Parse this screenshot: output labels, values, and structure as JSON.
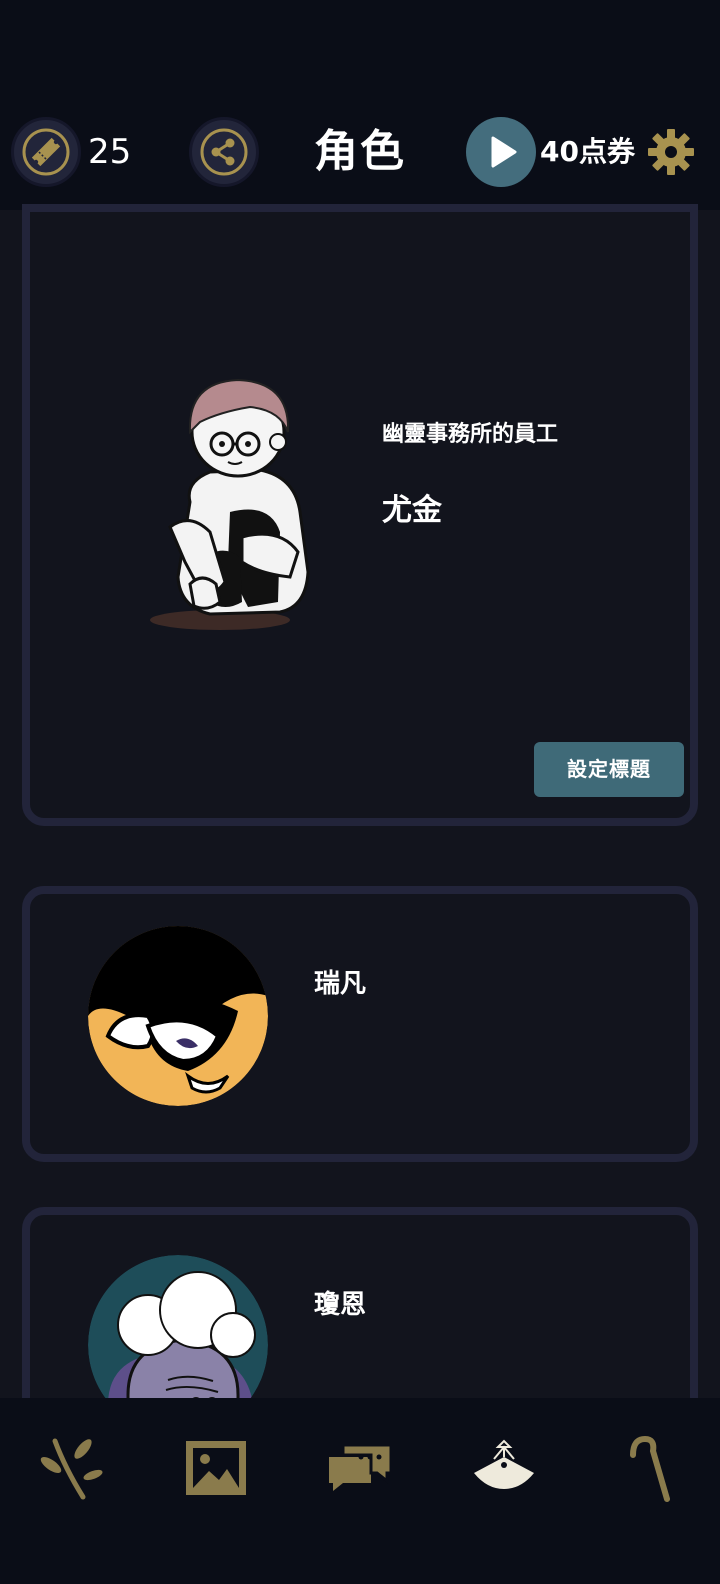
{
  "header": {
    "ticket_count": "25",
    "title": "角色",
    "points_label": "40点券"
  },
  "featured_character": {
    "subtitle": "幽靈事務所的員工",
    "name": "尤金",
    "set_title_button": "設定標題"
  },
  "characters": [
    {
      "name": "瑞凡"
    },
    {
      "name": "瓊恩"
    }
  ],
  "bottom_nav": [
    {
      "icon": "branch-icon"
    },
    {
      "icon": "gallery-icon"
    },
    {
      "icon": "chat-icon"
    },
    {
      "icon": "fan-icon"
    },
    {
      "icon": "cane-icon"
    }
  ],
  "colors": {
    "accent_gold": "#a8924f",
    "button_teal": "#3f6a78",
    "background": "#12141d",
    "header_bg": "#0a0d17"
  }
}
